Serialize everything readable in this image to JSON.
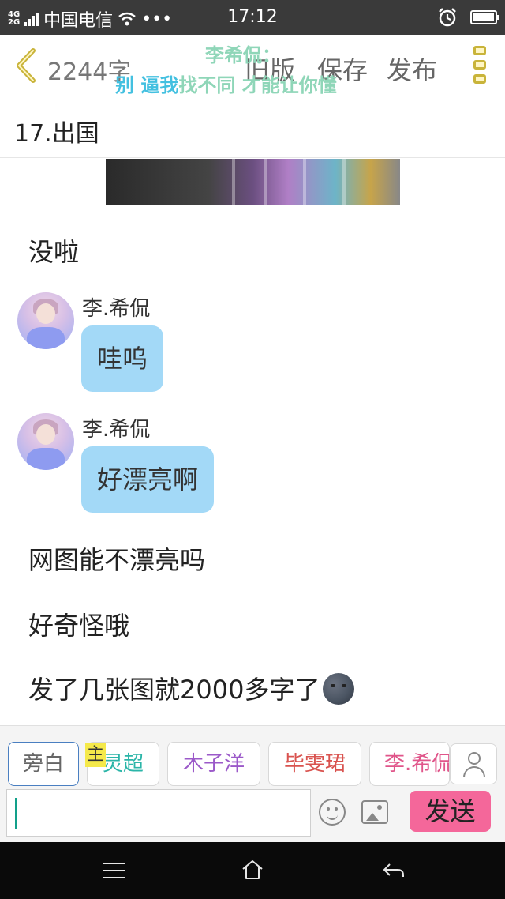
{
  "status_bar": {
    "network": "4G",
    "network2": "2G",
    "carrier": "中国电信",
    "more": "•••",
    "time": "17:12"
  },
  "header": {
    "word_count": "2244字",
    "old_version": "旧版",
    "save": "保存",
    "publish": "发布",
    "overlay_line1": "李希侃：",
    "overlay_line2a": "别 逼我",
    "overlay_line2b": "找不同 才能让你懂"
  },
  "chapter": {
    "title": "17.出国"
  },
  "content": {
    "narr1": "没啦",
    "messages": [
      {
        "name": "李.希侃",
        "text": "哇呜"
      },
      {
        "name": "李.希侃",
        "text": "好漂亮啊"
      }
    ],
    "narr2": "网图能不漂亮吗",
    "narr3": "好奇怪哦",
    "narr4": "发了几张图就2000多字了"
  },
  "toolbar": {
    "roles": [
      "旁白",
      "灵超",
      "木子洋",
      "毕雯珺",
      "李.希侃"
    ],
    "host_tag": "主",
    "role_colors": [
      "#666666",
      "#2bb5a8",
      "#9b59c9",
      "#d9534f",
      "#e0558a"
    ],
    "input_value": "",
    "send_label": "发送"
  }
}
